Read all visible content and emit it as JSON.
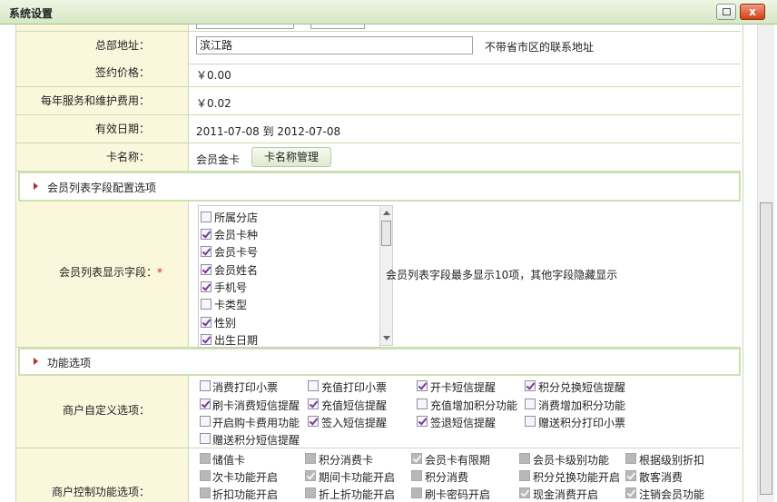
{
  "window": {
    "title": "系统设置",
    "close_glyph": "x"
  },
  "form": {
    "address": {
      "label": "总部地址：",
      "value": "滨江路",
      "hint": "不带省市区的联系地址"
    },
    "price": {
      "label": "签约价格：",
      "value": "￥0.00"
    },
    "fee": {
      "label": "每年服务和维护费用：",
      "value": "￥0.02"
    },
    "valid_date": {
      "label": "有效日期：",
      "value": "2011-07-08 到 2012-07-08"
    },
    "card_name": {
      "label": "卡名称：",
      "value": "会员金卡",
      "button": "卡名称管理"
    }
  },
  "section_member_list": {
    "title": "会员列表字段配置选项"
  },
  "member_fields": {
    "label": "会员列表显示字段：",
    "required_mark": "*",
    "note": "会员列表字段最多显示10项，其他字段隐藏显示",
    "items": [
      {
        "label": "所属分店",
        "checked": false
      },
      {
        "label": "会员卡种",
        "checked": true
      },
      {
        "label": "会员卡号",
        "checked": true
      },
      {
        "label": "会员姓名",
        "checked": true
      },
      {
        "label": "手机号",
        "checked": true
      },
      {
        "label": "卡类型",
        "checked": false
      },
      {
        "label": "性别",
        "checked": true
      },
      {
        "label": "出生日期",
        "checked": true
      }
    ]
  },
  "section_functions": {
    "title": "功能选项"
  },
  "merchant_options": {
    "label": "商户自定义选项：",
    "items": [
      {
        "label": "消费打印小票",
        "checked": false
      },
      {
        "label": "充值打印小票",
        "checked": false
      },
      {
        "label": "开卡短信提醒",
        "checked": true
      },
      {
        "label": "积分兑换短信提醒",
        "checked": true
      },
      {
        "label": "刷卡消费短信提醒",
        "checked": true
      },
      {
        "label": "充值短信提醒",
        "checked": true
      },
      {
        "label": "充值增加积分功能",
        "checked": false
      },
      {
        "label": "消费增加积分功能",
        "checked": false
      },
      {
        "label": "开启购卡费用功能",
        "checked": false
      },
      {
        "label": "签入短信提醒",
        "checked": true
      },
      {
        "label": "签退短信提醒",
        "checked": true
      },
      {
        "label": "赠送积分打印小票",
        "checked": false
      },
      {
        "label": "赠送积分短信提醒",
        "checked": false
      }
    ]
  },
  "merchant_control": {
    "label": "商户控制功能选项：",
    "items": [
      {
        "label": "储值卡",
        "checked": false
      },
      {
        "label": "积分消费卡",
        "checked": false
      },
      {
        "label": "会员卡有限期",
        "checked": true
      },
      {
        "label": "会员卡级别功能",
        "checked": false
      },
      {
        "label": "根据级别折扣",
        "checked": false
      },
      {
        "label": "次卡功能开启",
        "checked": false
      },
      {
        "label": "期间卡功能开启",
        "checked": true
      },
      {
        "label": "积分消费",
        "checked": false
      },
      {
        "label": "积分兑换功能开启",
        "checked": false
      },
      {
        "label": "散客消费",
        "checked": true
      },
      {
        "label": "折扣功能开启",
        "checked": false
      },
      {
        "label": "折上折功能开启",
        "checked": false
      },
      {
        "label": "刷卡密码开启",
        "checked": false
      },
      {
        "label": "现金消费开启",
        "checked": true
      },
      {
        "label": "注销会员功能",
        "checked": true
      }
    ]
  }
}
